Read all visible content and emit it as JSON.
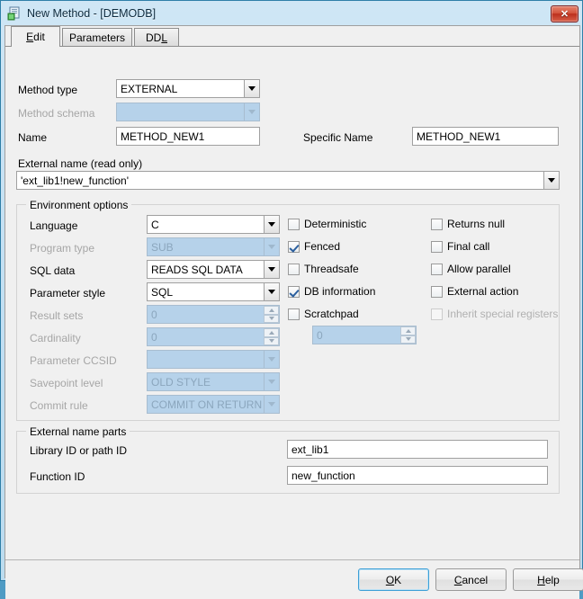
{
  "window": {
    "title": "New Method - [DEMODB]",
    "icon": "method-window-icon",
    "close_label": "✕"
  },
  "tabs": [
    {
      "label": "Edit",
      "active": true
    },
    {
      "label": "Parameters",
      "active": false
    },
    {
      "label": "DDL",
      "active": false
    }
  ],
  "form": {
    "method_type_label": "Method type",
    "method_type_value": "EXTERNAL",
    "method_schema_label": "Method schema",
    "method_schema_value": "",
    "name_label": "Name",
    "name_value": "METHOD_NEW1",
    "specific_name_label": "Specific Name",
    "specific_name_value": "METHOD_NEW1",
    "external_name_label": "External name (read only)",
    "external_name_value": "'ext_lib1!new_function'"
  },
  "environment": {
    "group_title": "Environment options",
    "fields": [
      {
        "label": "Language",
        "value": "C",
        "disabled": false,
        "kind": "combo"
      },
      {
        "label": "Program type",
        "value": "SUB",
        "disabled": true,
        "kind": "combo"
      },
      {
        "label": "SQL data",
        "value": "READS SQL DATA",
        "disabled": false,
        "kind": "combo"
      },
      {
        "label": "Parameter style",
        "value": "SQL",
        "disabled": false,
        "kind": "combo"
      },
      {
        "label": "Result sets",
        "value": "0",
        "disabled": true,
        "kind": "spin"
      },
      {
        "label": "Cardinality",
        "value": "0",
        "disabled": true,
        "kind": "spin"
      },
      {
        "label": "Parameter CCSID",
        "value": "",
        "disabled": true,
        "kind": "combo"
      },
      {
        "label": "Savepoint level",
        "value": "OLD STYLE",
        "disabled": true,
        "kind": "combo"
      },
      {
        "label": "Commit rule",
        "value": "COMMIT ON RETURN N",
        "disabled": true,
        "kind": "combo"
      }
    ],
    "checkboxes_col1": [
      {
        "label": "Deterministic",
        "checked": false,
        "disabled": false
      },
      {
        "label": "Fenced",
        "checked": true,
        "disabled": false
      },
      {
        "label": "Threadsafe",
        "checked": false,
        "disabled": false
      },
      {
        "label": "DB information",
        "checked": true,
        "disabled": false
      },
      {
        "label": "Scratchpad",
        "checked": false,
        "disabled": false
      }
    ],
    "checkboxes_col2": [
      {
        "label": "Returns null",
        "checked": false,
        "disabled": false
      },
      {
        "label": "Final call",
        "checked": false,
        "disabled": false
      },
      {
        "label": "Allow parallel",
        "checked": false,
        "disabled": false
      },
      {
        "label": "External action",
        "checked": false,
        "disabled": false
      },
      {
        "label": "Inherit special registers",
        "checked": false,
        "disabled": true
      }
    ],
    "scratchpad_size": "0"
  },
  "external_parts": {
    "group_title": "External name parts",
    "library_label": "Library ID or path ID",
    "library_value": "ext_lib1",
    "function_label": "Function ID",
    "function_value": "new_function"
  },
  "footer": {
    "ok": "OK",
    "cancel": "Cancel",
    "help": "Help"
  },
  "colors": {
    "titlebar": "#c2dff2",
    "window_border": "#2f7fa8",
    "panel_bg": "#f0f0f0",
    "disabled_field": "#b6d2ea",
    "default_button_focus": "#3c9fd6",
    "close_button": "#bc2f1c"
  }
}
